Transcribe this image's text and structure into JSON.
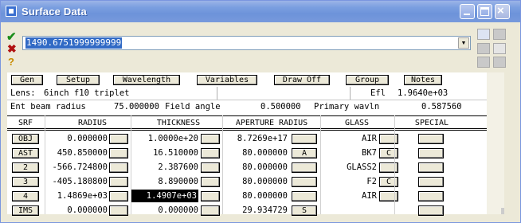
{
  "window": {
    "title": "Surface Data",
    "close_glyph": "×"
  },
  "command": {
    "value": "1490.6751999999999"
  },
  "toolbar_icons": [
    "check-icon",
    "cancel-icon",
    "help-icon"
  ],
  "toolbar_glyphs": {
    "check": "✔",
    "cancel": "✖",
    "help": "?",
    "dropdown": "▼"
  },
  "buttons": [
    "Gen",
    "Setup",
    "Wavelength",
    "Variables",
    "Draw Off",
    "Group",
    "Notes"
  ],
  "lens_line": {
    "label": "Lens:",
    "name": "6inch f10 triplet",
    "efl_label": "Efl",
    "efl_value": "1.9640e+03"
  },
  "beam_line": {
    "ebr_label": "Ent beam radius",
    "ebr_value": "75.000000",
    "fa_label": "Field angle",
    "fa_value": "0.500000",
    "pw_label": "Primary wavln",
    "pw_value": "0.587560"
  },
  "columns": [
    "SRF",
    "RADIUS",
    "THICKNESS",
    "APERTURE RADIUS",
    "GLASS",
    "SPECIAL"
  ],
  "rows": [
    {
      "srf": "OBJ",
      "radius": "0.000000",
      "thickness": "1.0000e+20",
      "aperture": "8.7269e+17",
      "aperture_flag": "",
      "glass": "AIR",
      "glass_flag": ""
    },
    {
      "srf": "AST",
      "radius": "450.850000",
      "thickness": "16.510000",
      "aperture": "80.000000",
      "aperture_flag": "A",
      "glass": "BK7",
      "glass_flag": "C"
    },
    {
      "srf": "2",
      "radius": "-566.724800",
      "thickness": "2.387600",
      "aperture": "80.000000",
      "aperture_flag": "",
      "glass": "GLASS2",
      "glass_flag": ""
    },
    {
      "srf": "3",
      "radius": "-405.180800",
      "thickness": "8.890000",
      "aperture": "80.000000",
      "aperture_flag": "",
      "glass": "F2",
      "glass_flag": "C"
    },
    {
      "srf": "4",
      "radius": "1.4869e+03",
      "thickness": "1.4907e+03",
      "aperture": "80.000000",
      "aperture_flag": "",
      "glass": "AIR",
      "glass_flag": ""
    },
    {
      "srf": "IMS",
      "radius": "0.000000",
      "thickness": "0.000000",
      "aperture": "29.934729",
      "aperture_flag": "S",
      "glass": "",
      "glass_flag": ""
    }
  ],
  "selected_cell": {
    "row": 4,
    "column": "thickness"
  }
}
